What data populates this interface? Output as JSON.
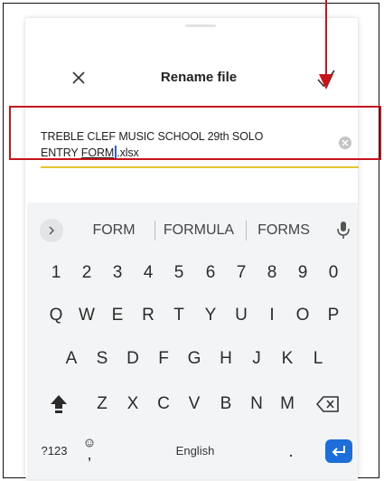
{
  "dialog": {
    "title": "Rename file",
    "filename_before_cursor_part1": "TREBLE CLEF MUSIC SCHOOL 29th SOLO",
    "filename_line2_prefix": "ENTRY ",
    "filename_underlined_word": "FORM",
    "filename_after_cursor": ".xlsx"
  },
  "keyboard": {
    "suggestions": [
      "FORM",
      "FORMULA",
      "FORMS"
    ],
    "number_row": [
      "1",
      "2",
      "3",
      "4",
      "5",
      "6",
      "7",
      "8",
      "9",
      "0"
    ],
    "row1": [
      "Q",
      "W",
      "E",
      "R",
      "T",
      "Y",
      "U",
      "I",
      "O",
      "P"
    ],
    "row2": [
      "A",
      "S",
      "D",
      "F",
      "G",
      "H",
      "J",
      "K",
      "L"
    ],
    "row3": [
      "Z",
      "X",
      "C",
      "V",
      "B",
      "N",
      "M"
    ],
    "symbols_label": "?123",
    "emoji_comma_label": ",",
    "space_label": "English",
    "period_label": "."
  },
  "colors": {
    "annotation_red": "#c4141c",
    "accent_underline": "#e6c32d",
    "enter_blue": "#1d6ed8"
  }
}
